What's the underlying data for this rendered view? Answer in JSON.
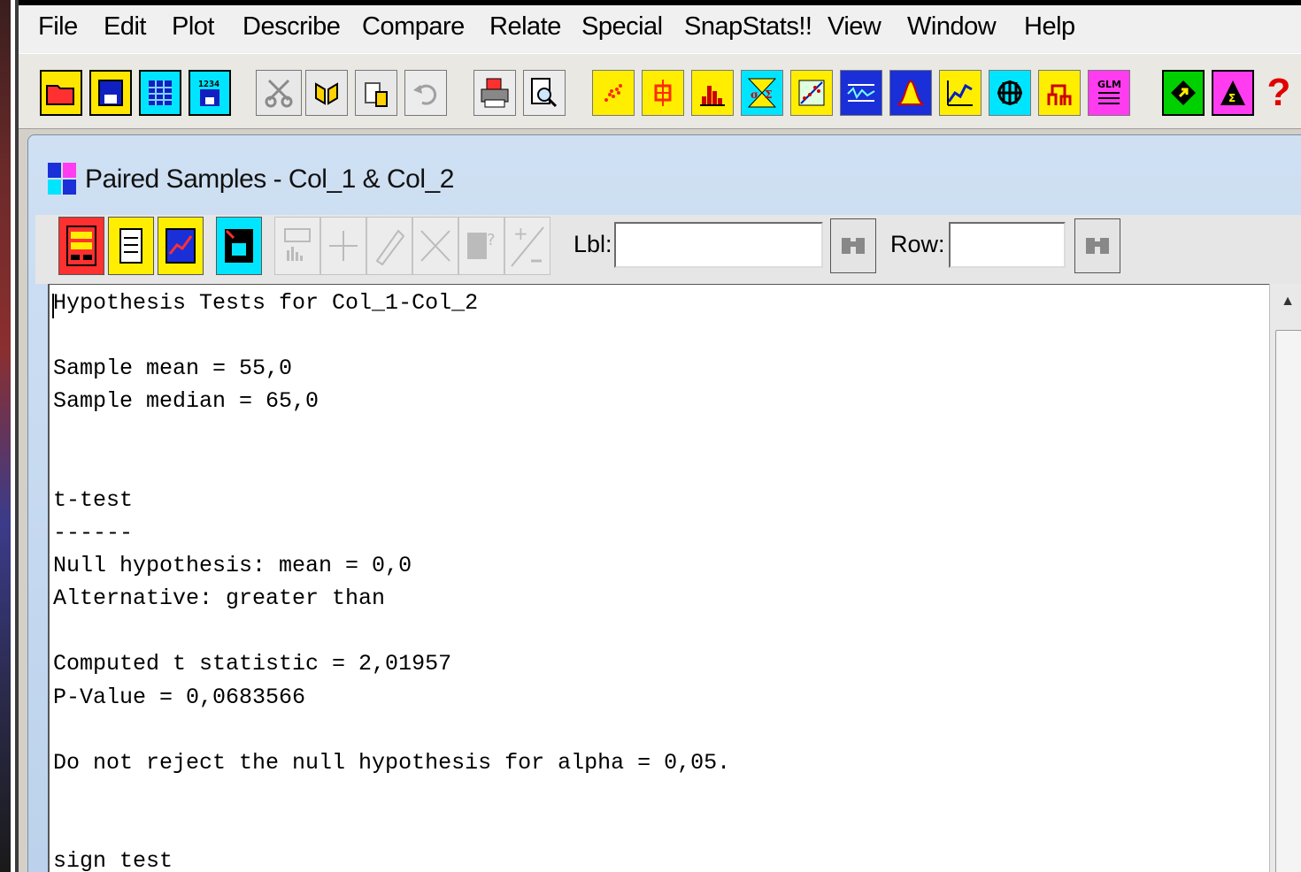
{
  "menu": [
    "File",
    "Edit",
    "Plot",
    "Describe",
    "Compare",
    "Relate",
    "Special",
    "SnapStats!!",
    "View",
    "Window",
    "Help"
  ],
  "toolbar_icons": [
    "open-folder-icon",
    "save-disk-icon",
    "spreadsheet-icon",
    "save-data-icon",
    "cut-icon",
    "copy-icon",
    "paste-icon",
    "undo-icon",
    "print-icon",
    "print-preview-icon",
    "scatterplot-icon",
    "box-whisker-icon",
    "histogram-icon",
    "hypothesis-test-icon",
    "xy-plot-icon",
    "control-chart-icon",
    "normal-curve-icon",
    "time-series-icon",
    "grid-plot-icon",
    "dendrogram-icon",
    "glm-icon",
    "statadvisor-icon",
    "statgallery-icon",
    "help-icon"
  ],
  "glm_label": "GLM",
  "help_glyph": "?",
  "child_window": {
    "title": "Paired Samples - Col_1 & Col_2",
    "lbl_label": "Lbl:",
    "lbl_value": "",
    "row_label": "Row:",
    "row_value": ""
  },
  "output_lines": [
    "Hypothesis Tests for Col_1-Col_2",
    "",
    "Sample mean = 55,0",
    "Sample median = 65,0",
    "",
    "",
    "t-test",
    "------",
    "Null hypothesis: mean = 0,0",
    "Alternative: greater than",
    "",
    "Computed t statistic = 2,01957",
    "P-Value = 0,0683566",
    "",
    "Do not reject the null hypothesis for alpha = 0,05.",
    "",
    "",
    "sign test"
  ],
  "colors": {
    "accent_yellow": "#ffff00",
    "accent_cyan": "#00e5ff",
    "accent_red": "#ff0000",
    "title_gradient": "#cfe0f3"
  }
}
